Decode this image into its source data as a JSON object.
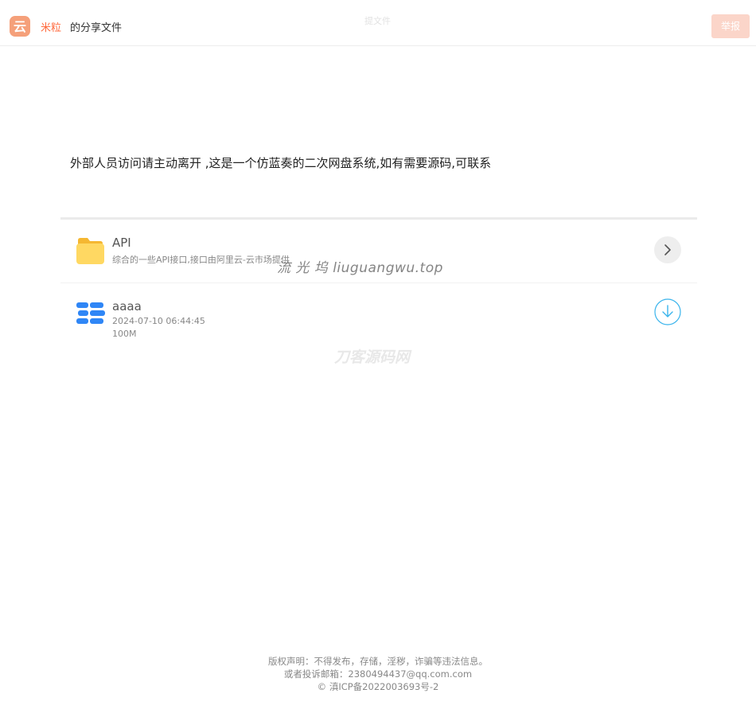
{
  "header": {
    "logo_icon": "cloud-logo-icon",
    "logo_glyph": "云",
    "username": "米粒",
    "share_label": "的分享文件",
    "ghost_title": "提文件",
    "report_label": "举报",
    "accent_color": "#ff6a3d"
  },
  "description": "外部人员访问请主动离开 ,这是一个仿蓝奏的二次网盘系统,如有需要源码,可联系",
  "items": [
    {
      "type": "folder",
      "icon": "folder-icon",
      "name": "API",
      "description": "综合的一些API接口,接口由阿里云-云市场提供",
      "action_icon": "chevron-right-icon"
    },
    {
      "type": "file",
      "icon": "file-icon",
      "name": "aaaa",
      "date": "2024-07-10 06:44:45",
      "size": "100M",
      "action_icon": "download-icon"
    }
  ],
  "watermarks": {
    "primary": "流 光 坞 liuguangwu.top",
    "secondary": "刀客源码网"
  },
  "footer": {
    "line1": "版权声明：不得发布，存储，淫秽，诈骗等违法信息。",
    "line2": "或者投诉邮箱：2380494437@qq.com.com",
    "line3": "© 滇ICP备2022003693号-2"
  }
}
